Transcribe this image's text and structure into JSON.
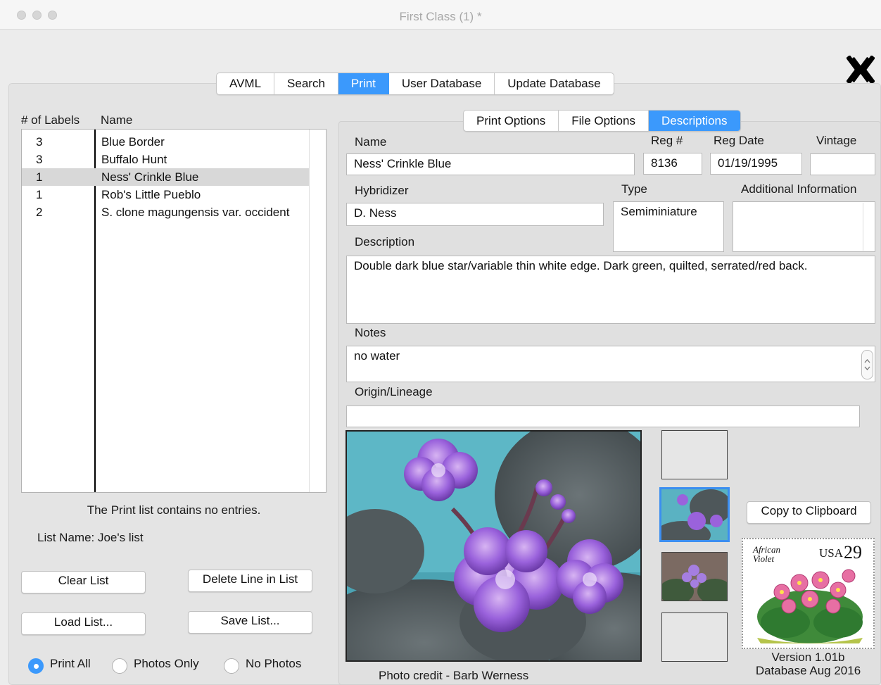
{
  "window": {
    "title": "First Class (1) *"
  },
  "main_tabs": [
    {
      "label": "AVML",
      "selected": false
    },
    {
      "label": "Search",
      "selected": false
    },
    {
      "label": "Print",
      "selected": true
    },
    {
      "label": "User Database",
      "selected": false
    },
    {
      "label": "Update Database",
      "selected": false
    }
  ],
  "sub_tabs": [
    {
      "label": "Print Options",
      "selected": false
    },
    {
      "label": "File Options",
      "selected": false
    },
    {
      "label": "Descriptions",
      "selected": true
    }
  ],
  "list": {
    "columns": [
      "# of Labels",
      "Name"
    ],
    "rows": [
      {
        "count": "3",
        "name": "Blue Border"
      },
      {
        "count": "3",
        "name": "Buffalo Hunt"
      },
      {
        "count": "1",
        "name": "Ness' Crinkle Blue"
      },
      {
        "count": "1",
        "name": "Rob's Little Pueblo"
      },
      {
        "count": "2",
        "name": "S. clone magungensis var. occident"
      }
    ],
    "status": "The Print list contains no entries.",
    "list_name": "List Name: Joe's list"
  },
  "buttons": {
    "clear_list": "Clear List",
    "delete_line": "Delete Line in List",
    "load_list": "Load List...",
    "save_list": "Save List...",
    "copy_clipboard": "Copy to Clipboard"
  },
  "radios": {
    "print_all": "Print All",
    "photos_only": "Photos Only",
    "no_photos": "No Photos"
  },
  "form": {
    "name_label": "Name",
    "name_value": "Ness' Crinkle Blue",
    "reg_label": "Reg #",
    "reg_value": "8136",
    "reg_date_label": "Reg Date",
    "reg_date_value": "01/19/1995",
    "vintage_label": "Vintage",
    "vintage_value": "",
    "hybridizer_label": "Hybridizer",
    "hybridizer_value": "D. Ness",
    "type_label": "Type",
    "type_value": "Semiminiature",
    "additional_label": "Additional Information",
    "additional_value": "",
    "description_label": "Description",
    "description_value": "Double dark blue star/variable thin white edge. Dark green, quilted, serrated/red back.",
    "notes_label": "Notes",
    "notes_value": "no water",
    "origin_label": "Origin/Lineage",
    "origin_value": ""
  },
  "photo": {
    "credit": "Photo credit - Barb Werness"
  },
  "stamp": {
    "text_name": "African Violet",
    "text_country": "USA",
    "text_value": "29"
  },
  "version": {
    "line1": "Version 1.01b",
    "line2": "Database Aug 2016"
  },
  "colors": {
    "accent": "#3b99fc",
    "selection": "#d8d8d8"
  }
}
